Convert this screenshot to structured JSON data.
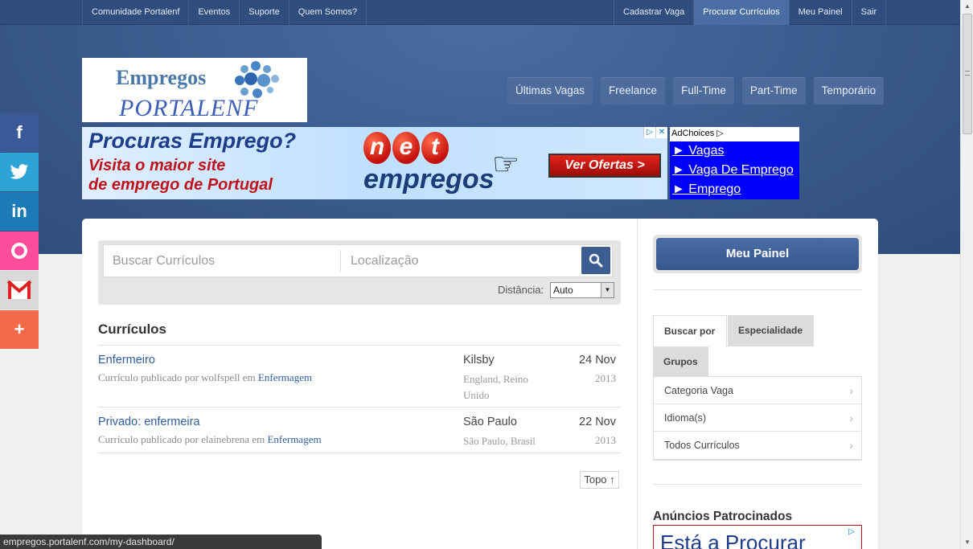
{
  "topnav": {
    "left": [
      "Comunidade Portalenf",
      "Eventos",
      "Suporte",
      "Quem Somos?"
    ],
    "right": [
      "Cadastrar Vaga",
      "Procurar Currículos",
      "Meu Painel",
      "Sair"
    ],
    "active": "Procurar Currículos"
  },
  "logo": {
    "line1": "Empregos",
    "line2": "PORTALENF"
  },
  "mainnav": [
    "Últimas Vagas",
    "Freelance",
    "Full-Time",
    "Part-Time",
    "Temporário"
  ],
  "banner": {
    "line1": "Procuras Emprego?",
    "line2": "Visita o maior site",
    "line3": "de emprego de Portugal",
    "brand_top": [
      "n",
      "e",
      "t"
    ],
    "brand_bottom": "empregos",
    "cta": "Ver Ofertas >"
  },
  "adchoices": {
    "label": "AdChoices",
    "links": [
      "► Vagas",
      "► Vaga De Emprego",
      "► Emprego"
    ]
  },
  "social": [
    "f",
    "t",
    "in",
    "O",
    "M",
    "+"
  ],
  "search": {
    "keyword_placeholder": "Buscar Currículos",
    "location_placeholder": "Localização",
    "distance_label": "Distância:",
    "distance_value": "Auto"
  },
  "results": {
    "title": "Currículos",
    "items": [
      {
        "title": "Enfermeiro",
        "meta": "Currículo publicado por wolfspell em ",
        "category": "Enfermagem",
        "city": "Kilsby",
        "region": "England, Reino Unido",
        "date": "24 Nov",
        "year": "2013"
      },
      {
        "title": "Privado: enfermeira",
        "meta": "Currículo publicado por elainebrena em ",
        "category": "Enfermagem",
        "city": "São Paulo",
        "region": "São Paulo, Brasil",
        "date": "22 Nov",
        "year": "2013"
      }
    ],
    "top_link": "Topo ↑"
  },
  "sidebar": {
    "dashboard_button": "Meu Painel",
    "tabs": [
      "Buscar por",
      "Especialidade",
      "Grupos"
    ],
    "filters": [
      "Categoria Vaga",
      "Idioma(s)",
      "Todos Currículos"
    ],
    "sponsored_title": "Anúncios Patrocinados",
    "sponsored_ad_text": "Está a Procurar"
  },
  "status_url": "empregos.portalenf.com/my-dashboard/",
  "colors": {
    "nav": "#2f4e7d",
    "header": "#3a5a8c",
    "link": "#2f5e9e",
    "button": "#3b5d92"
  }
}
